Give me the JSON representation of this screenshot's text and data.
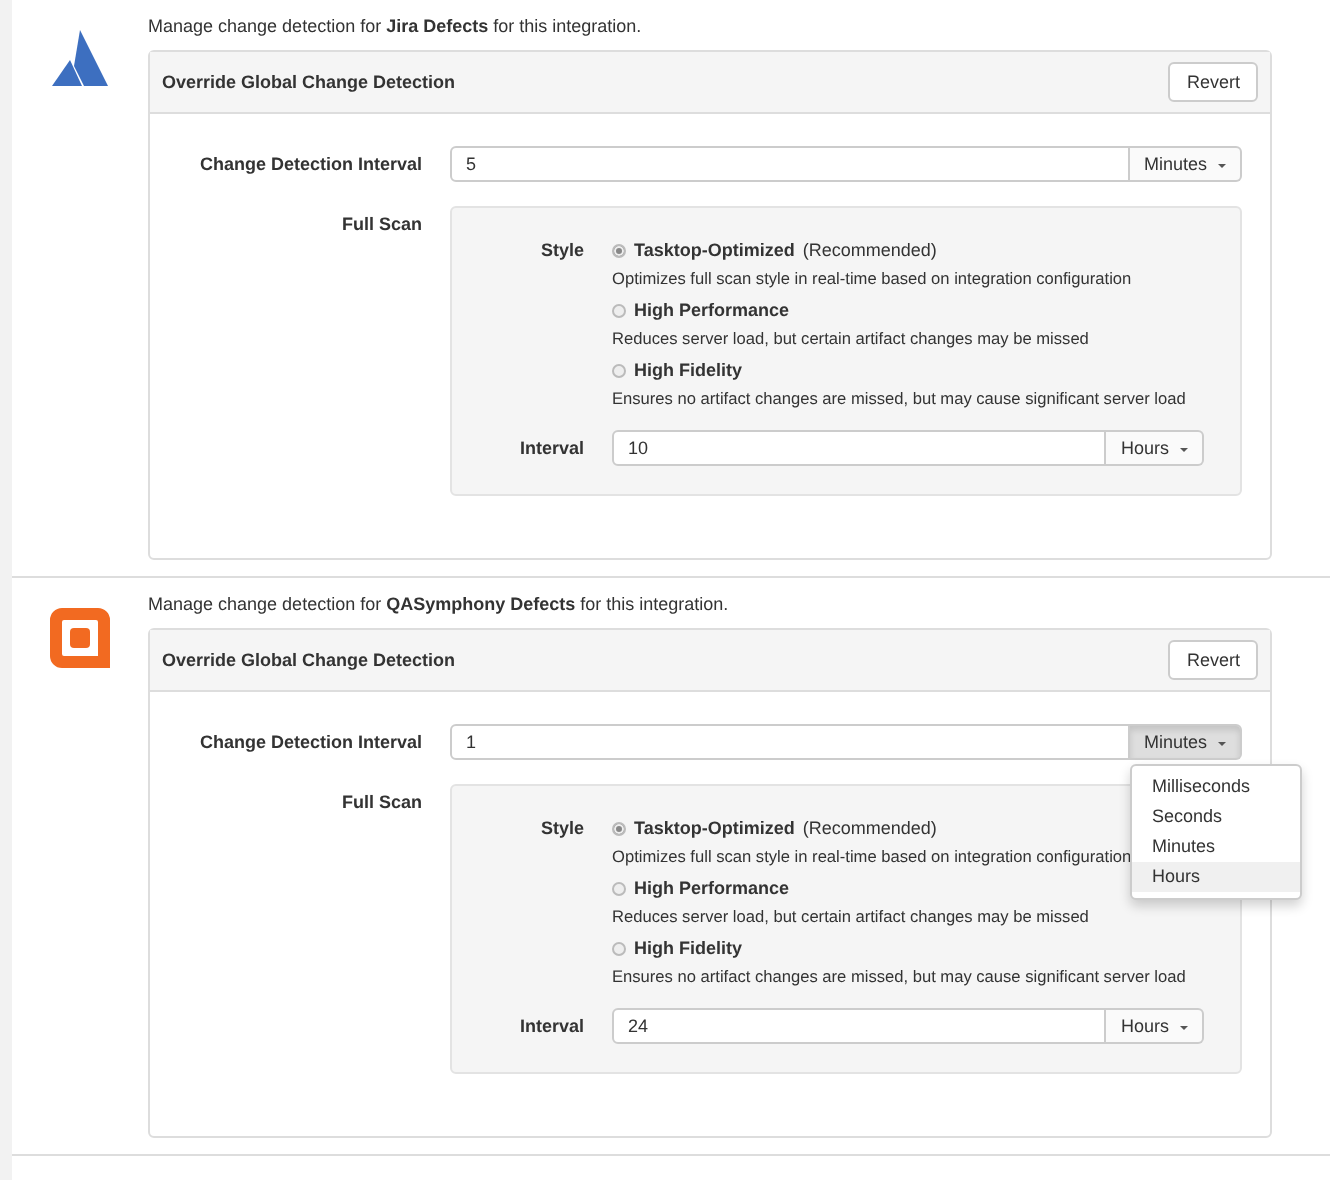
{
  "integrations": [
    {
      "logo": {
        "kind": "triangle"
      },
      "intro": "Manage change detection for **Jira Defects** for this integration.",
      "header": "Override Global Change Detection",
      "revert": "Revert",
      "interval_label": "Change Detection Interval",
      "interval": {
        "value": "5",
        "unit": "Minutes",
        "menu_open": false
      },
      "full_scan_label": "Full Scan",
      "style_label": "Style",
      "styles": [
        {
          "title": "Tasktop-Optimized",
          "note": "(Recommended)",
          "description": "Optimizes full scan style in real-time based on integration configuration",
          "selected": true
        },
        {
          "title": "High Performance",
          "description": "Reduces server load, but certain artifact changes may be missed",
          "selected": false
        },
        {
          "title": "High Fidelity",
          "description": "Ensures no artifact changes are missed, but may cause significant server load",
          "selected": false
        }
      ],
      "scan_interval_label": "Interval",
      "scan_interval": {
        "value": "10",
        "unit": "Hours"
      }
    },
    {
      "logo": {
        "kind": "square"
      },
      "intro": "Manage change detection for **QASymphony Defects** for this integration.",
      "header": "Override Global Change Detection",
      "revert": "Revert",
      "interval_label": "Change Detection Interval",
      "interval": {
        "value": "1",
        "unit": "Minutes",
        "menu_open": true,
        "menu": [
          {
            "label": "Milliseconds",
            "highlighted": false
          },
          {
            "label": "Seconds",
            "highlighted": false
          },
          {
            "label": "Minutes",
            "highlighted": false
          },
          {
            "label": "Hours",
            "highlighted": true
          }
        ]
      },
      "full_scan_label": "Full Scan",
      "style_label": "Style",
      "styles": [
        {
          "title": "Tasktop-Optimized",
          "note": "(Recommended)",
          "description": "Optimizes full scan style in real-time based on integration configuration",
          "selected": true
        },
        {
          "title": "High Performance",
          "description": "Reduces server load, but certain artifact changes may be missed",
          "selected": false
        },
        {
          "title": "High Fidelity",
          "description": "Ensures no artifact changes are missed, but may cause significant server load",
          "selected": false
        }
      ],
      "scan_interval_label": "Interval",
      "scan_interval": {
        "value": "24",
        "unit": "Hours"
      }
    }
  ]
}
